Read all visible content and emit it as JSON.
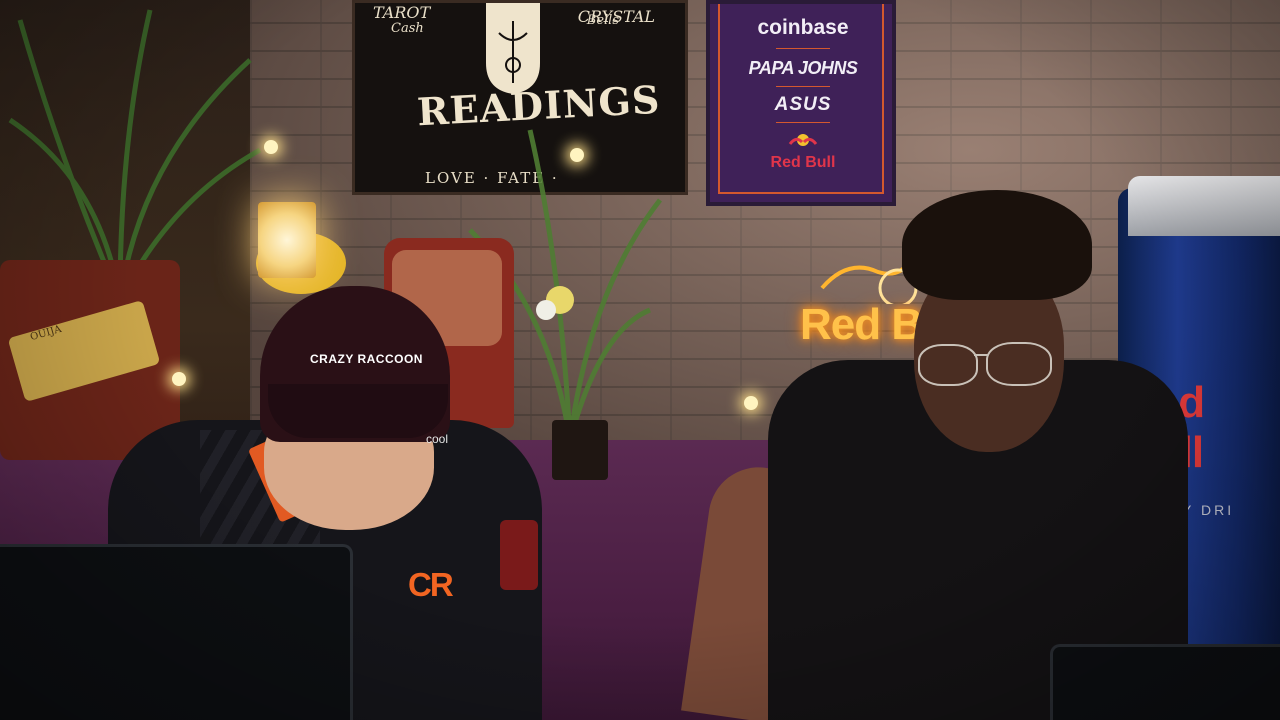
{
  "tarot_poster": {
    "top_left": "TAROT",
    "top_right": "CRYSTAL",
    "script_left": "Cash",
    "script_right": "Bells",
    "headline": "READINGS",
    "footer": "LOVE · FATE ·"
  },
  "sponsor_poster": {
    "items": [
      "coinbase",
      "PAPA JOHNS",
      "ASUS",
      "Red Bull"
    ]
  },
  "neon_sign": {
    "text": "Red Bull"
  },
  "fridge": {
    "brand": "Red Bull",
    "tagline": "Y DRI"
  },
  "ouija_board": {
    "text": "OUIJA"
  },
  "player_left": {
    "cap_text": "CRAZY RACCOON",
    "jersey_logo": "CR",
    "jersey_sponsor": "cool"
  },
  "colors": {
    "neon": "#ffc14a",
    "jersey_orange": "#f26522",
    "carpet": "#4a1e42",
    "fridge_blue": "#1f3b8f",
    "redbull_red": "#e23a3a"
  }
}
